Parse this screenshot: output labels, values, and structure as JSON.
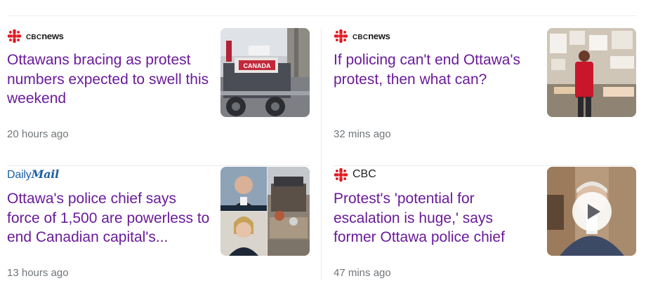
{
  "cards": [
    {
      "source": {
        "logo": "cbc-news-logo",
        "brand": "CBC",
        "word": "news"
      },
      "headline": "Ottawans bracing as protest numbers expected to swell this weekend",
      "time": "20 hours ago",
      "thumbnail": {
        "image": "truck-convoy-photo",
        "sign_text": "CANADA"
      }
    },
    {
      "source": {
        "logo": "cbc-news-logo",
        "brand": "CBC",
        "word": "news"
      },
      "headline": "If policing can't end Ottawa's protest, then what can?",
      "time": "32 mins ago",
      "thumbnail": {
        "image": "protester-at-memorial-photo"
      }
    },
    {
      "source": {
        "logo": "daily-mail-logo",
        "daily": "Daily",
        "mail": "Mail"
      },
      "headline": "Ottawa's police chief says force of 1,500 are powerless to end Canadian capital's...",
      "time": "13 hours ago",
      "thumbnail": {
        "image": "police-chief-collage-photo"
      }
    },
    {
      "source": {
        "logo": "cbc-gem-logo",
        "name": "CBC"
      },
      "headline": "Protest's 'potential for escalation is huge,' says former Ottawa police chief",
      "time": "47 mins ago",
      "thumbnail": {
        "image": "interview-video-frame",
        "play_icon": "play-icon"
      }
    }
  ],
  "colors": {
    "headline": "#6a1b9a",
    "timestamp": "#70757a",
    "cbc_red": "#e21b23",
    "daily_mail_blue": "#1d5fa8",
    "divider": "#ececec"
  }
}
